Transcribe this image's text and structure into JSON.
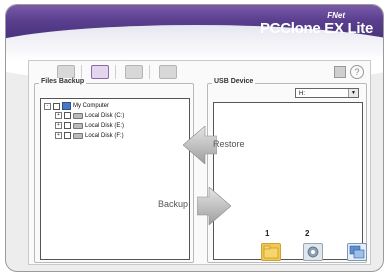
{
  "header": {
    "brand_small": "FNet",
    "brand_title": "PCClone EX Lite"
  },
  "files_backup": {
    "title": "Files Backup",
    "tree": [
      {
        "label": "My Computer",
        "type": "computer",
        "expander": "-"
      },
      {
        "label": "Local Disk (C:)",
        "type": "disk",
        "expander": "+"
      },
      {
        "label": "Local Disk (E:)",
        "type": "disk",
        "expander": "+"
      },
      {
        "label": "Local Disk (F:)",
        "type": "disk",
        "expander": "+"
      }
    ]
  },
  "usb_device": {
    "title": "USB Device",
    "selected_drive": "H:"
  },
  "arrows": {
    "restore": "Restore",
    "backup": "Backup"
  },
  "action_buttons": {
    "num1": "1",
    "num2": "2"
  },
  "colors": {
    "header_dark": "#3f2c74",
    "header_mid": "#5a3f8e",
    "arrow_gray": "#bdbdbd",
    "folder_yellow": "#f2c94c"
  }
}
